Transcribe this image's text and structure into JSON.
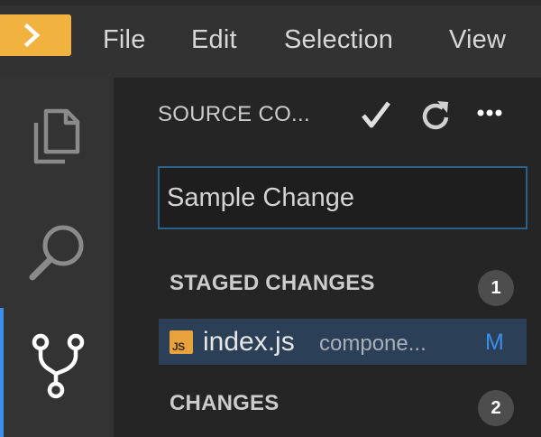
{
  "menubar": {
    "items": [
      "File",
      "Edit",
      "Selection",
      "View"
    ]
  },
  "activitybar": {
    "items": [
      {
        "icon": "files-icon",
        "label": "Explorer"
      },
      {
        "icon": "search-icon",
        "label": "Search"
      },
      {
        "icon": "source-control-icon",
        "label": "Source Control"
      }
    ],
    "active": "source-control"
  },
  "sidebar": {
    "title": "SOURCE CO...",
    "actions": [
      "commit-checkmark-icon",
      "refresh-icon",
      "more-icon"
    ],
    "commit_message": "Sample Change",
    "staged": {
      "header": "STAGED CHANGES",
      "count": "1",
      "files": [
        {
          "name": "index.js",
          "path": "compone...",
          "status": "M",
          "icon": "js-file-icon",
          "icon_text": "JS"
        }
      ]
    },
    "changes": {
      "header": "CHANGES",
      "count": "2"
    }
  },
  "colors": {
    "accent": "#f2b240",
    "active_indicator": "#3b8eea",
    "selected_row": "#2b3f57",
    "modified": "#3b8eea"
  }
}
